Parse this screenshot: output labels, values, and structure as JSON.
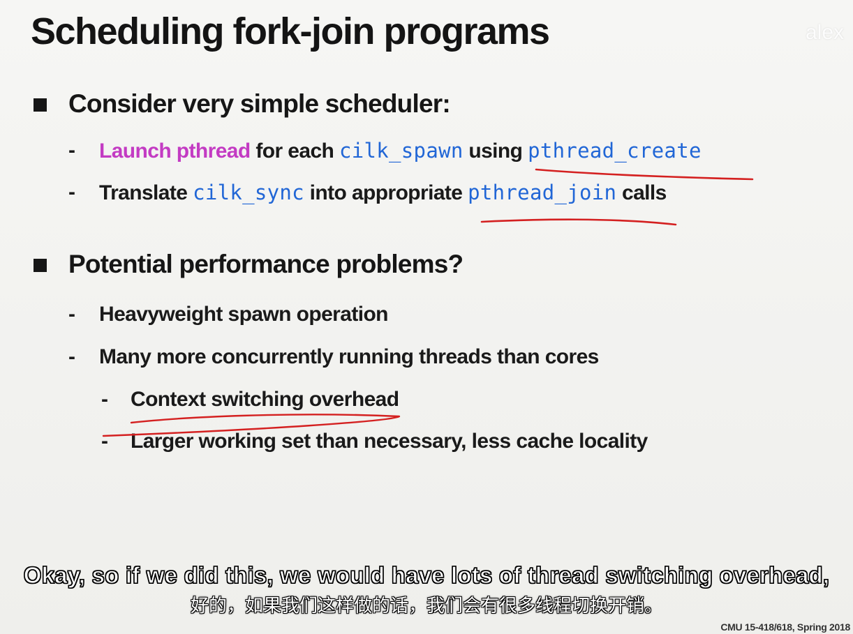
{
  "slide": {
    "title": "Scheduling fork-join programs",
    "watermark": "alex",
    "bullets": [
      {
        "text": "Consider very simple scheduler:",
        "subs": [
          {
            "parts": [
              {
                "text": "Launch pthread",
                "style": "magenta"
              },
              {
                "text": " for each ",
                "style": "plain"
              },
              {
                "text": "cilk_spawn",
                "style": "code"
              },
              {
                "text": " using ",
                "style": "plain"
              },
              {
                "text": "pthread_create",
                "style": "code"
              }
            ]
          },
          {
            "parts": [
              {
                "text": "Translate ",
                "style": "plain"
              },
              {
                "text": "cilk_sync",
                "style": "code"
              },
              {
                "text": " into appropriate ",
                "style": "plain"
              },
              {
                "text": "pthread_join",
                "style": "code"
              },
              {
                "text": " calls",
                "style": "plain"
              }
            ]
          }
        ]
      },
      {
        "text": "Potential performance problems?",
        "subs": [
          {
            "text": "Heavyweight spawn operation"
          },
          {
            "text": "Many more concurrently running threads than cores"
          }
        ],
        "subsubs": [
          {
            "text": "Context switching overhead"
          },
          {
            "text": "Larger working set than necessary, less cache locality"
          }
        ]
      }
    ],
    "dash": "-",
    "footer": "CMU 15-418/618, Spring 2018"
  },
  "subtitles": {
    "english": "Okay, so if we did this, we would have lots of thread switching overhead,",
    "chinese": "好的，如果我们这样做的话，我们会有很多线程切换开销。"
  },
  "colors": {
    "magenta_text": "#c33bc3",
    "code_text": "#2166d6",
    "annotation_ink": "#d42020",
    "bullet_text": "#161616"
  }
}
